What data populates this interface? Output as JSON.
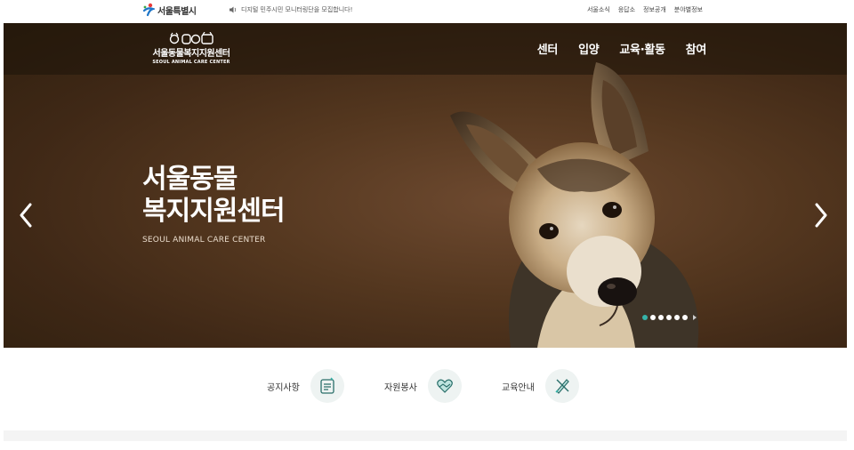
{
  "topbar": {
    "city_logo": "서울특별시",
    "notice": "디지털 민주시민 모니터링단을 모집합니다!",
    "links": [
      "서울소식",
      "응답소",
      "정보공개",
      "분야별정보"
    ]
  },
  "header": {
    "brand_ko": "서울동물복지지원센터",
    "brand_en": "SEOUL ANIMAL CARE CENTER",
    "nav": [
      "센터",
      "입양",
      "교육·활동",
      "참여"
    ]
  },
  "hero": {
    "title_line1": "서울동물",
    "title_line2": "복지지원센터",
    "subtitle": "SEOUL ANIMAL CARE CENTER",
    "slides_total": 6,
    "active_slide": 1
  },
  "quick_links": [
    {
      "label": "공지사항",
      "icon": "notice-icon"
    },
    {
      "label": "자원봉사",
      "icon": "volunteer-icon"
    },
    {
      "label": "교육안내",
      "icon": "education-icon"
    }
  ],
  "colors": {
    "accent": "#35b3a9",
    "hero_bg": "#54371f"
  }
}
